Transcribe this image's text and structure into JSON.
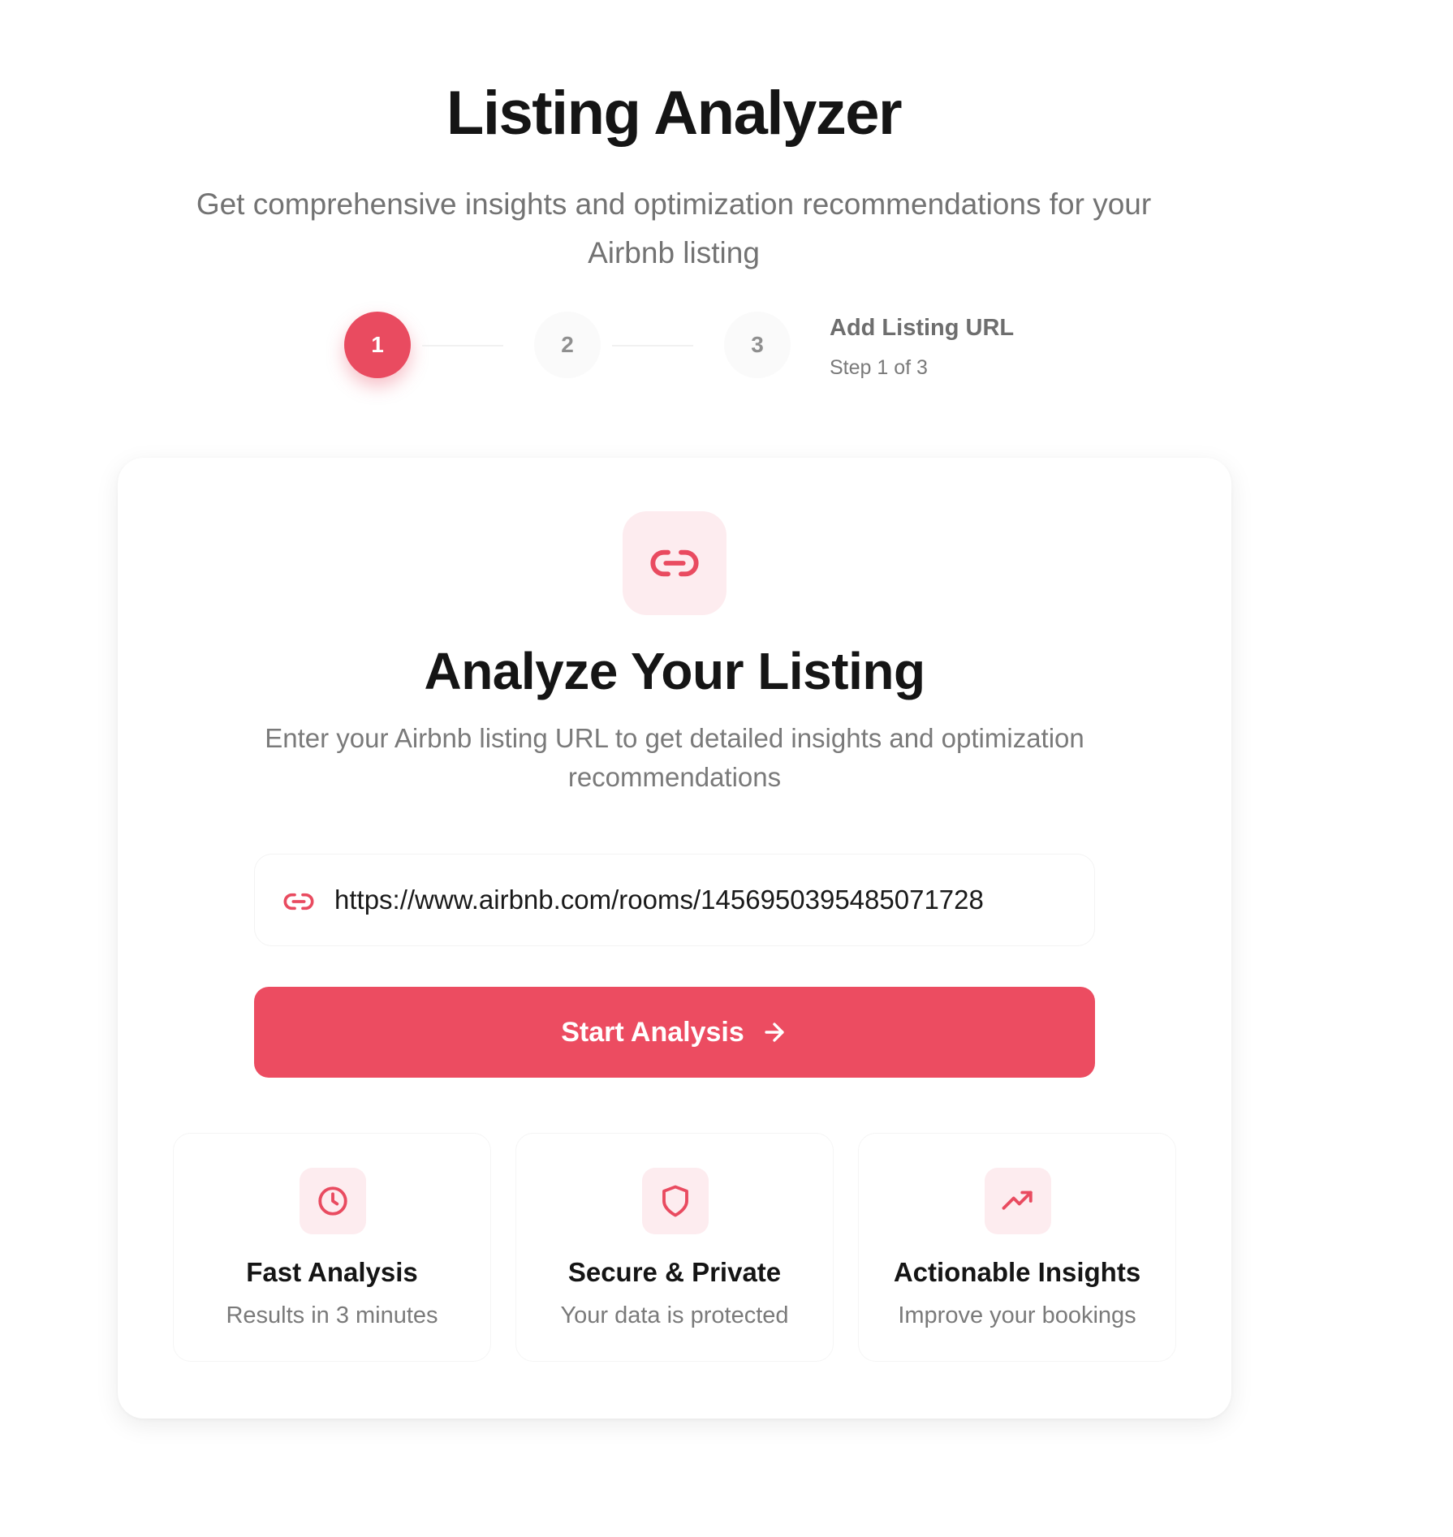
{
  "header": {
    "title": "Listing Analyzer",
    "subtitle": "Get comprehensive insights and optimization recommendations for your Airbnb listing"
  },
  "stepper": {
    "steps": [
      {
        "number": "1",
        "state": "active"
      },
      {
        "number": "2",
        "state": "inactive"
      },
      {
        "number": "3",
        "state": "inactive"
      }
    ],
    "current_title": "Add Listing URL",
    "current_count": "Step 1 of 3"
  },
  "card": {
    "icon": "link-icon",
    "title": "Analyze Your Listing",
    "description": "Enter your Airbnb listing URL to get detailed insights and optimization recommendations",
    "url_input": {
      "value": "https://www.airbnb.com/rooms/1456950395485071728",
      "icon": "link-icon"
    },
    "start_button": {
      "label": "Start Analysis",
      "icon": "arrow-right-icon"
    },
    "features": [
      {
        "icon": "clock-icon",
        "title": "Fast Analysis",
        "description": "Results in 3 minutes"
      },
      {
        "icon": "shield-icon",
        "title": "Secure & Private",
        "description": "Your data is protected"
      },
      {
        "icon": "trending-up-icon",
        "title": "Actionable Insights",
        "description": "Improve your bookings"
      }
    ]
  },
  "colors": {
    "accent": "#ec4c61",
    "accent_soft": "#fdecef",
    "text_primary": "#151515",
    "text_muted": "#7a7a7a"
  }
}
